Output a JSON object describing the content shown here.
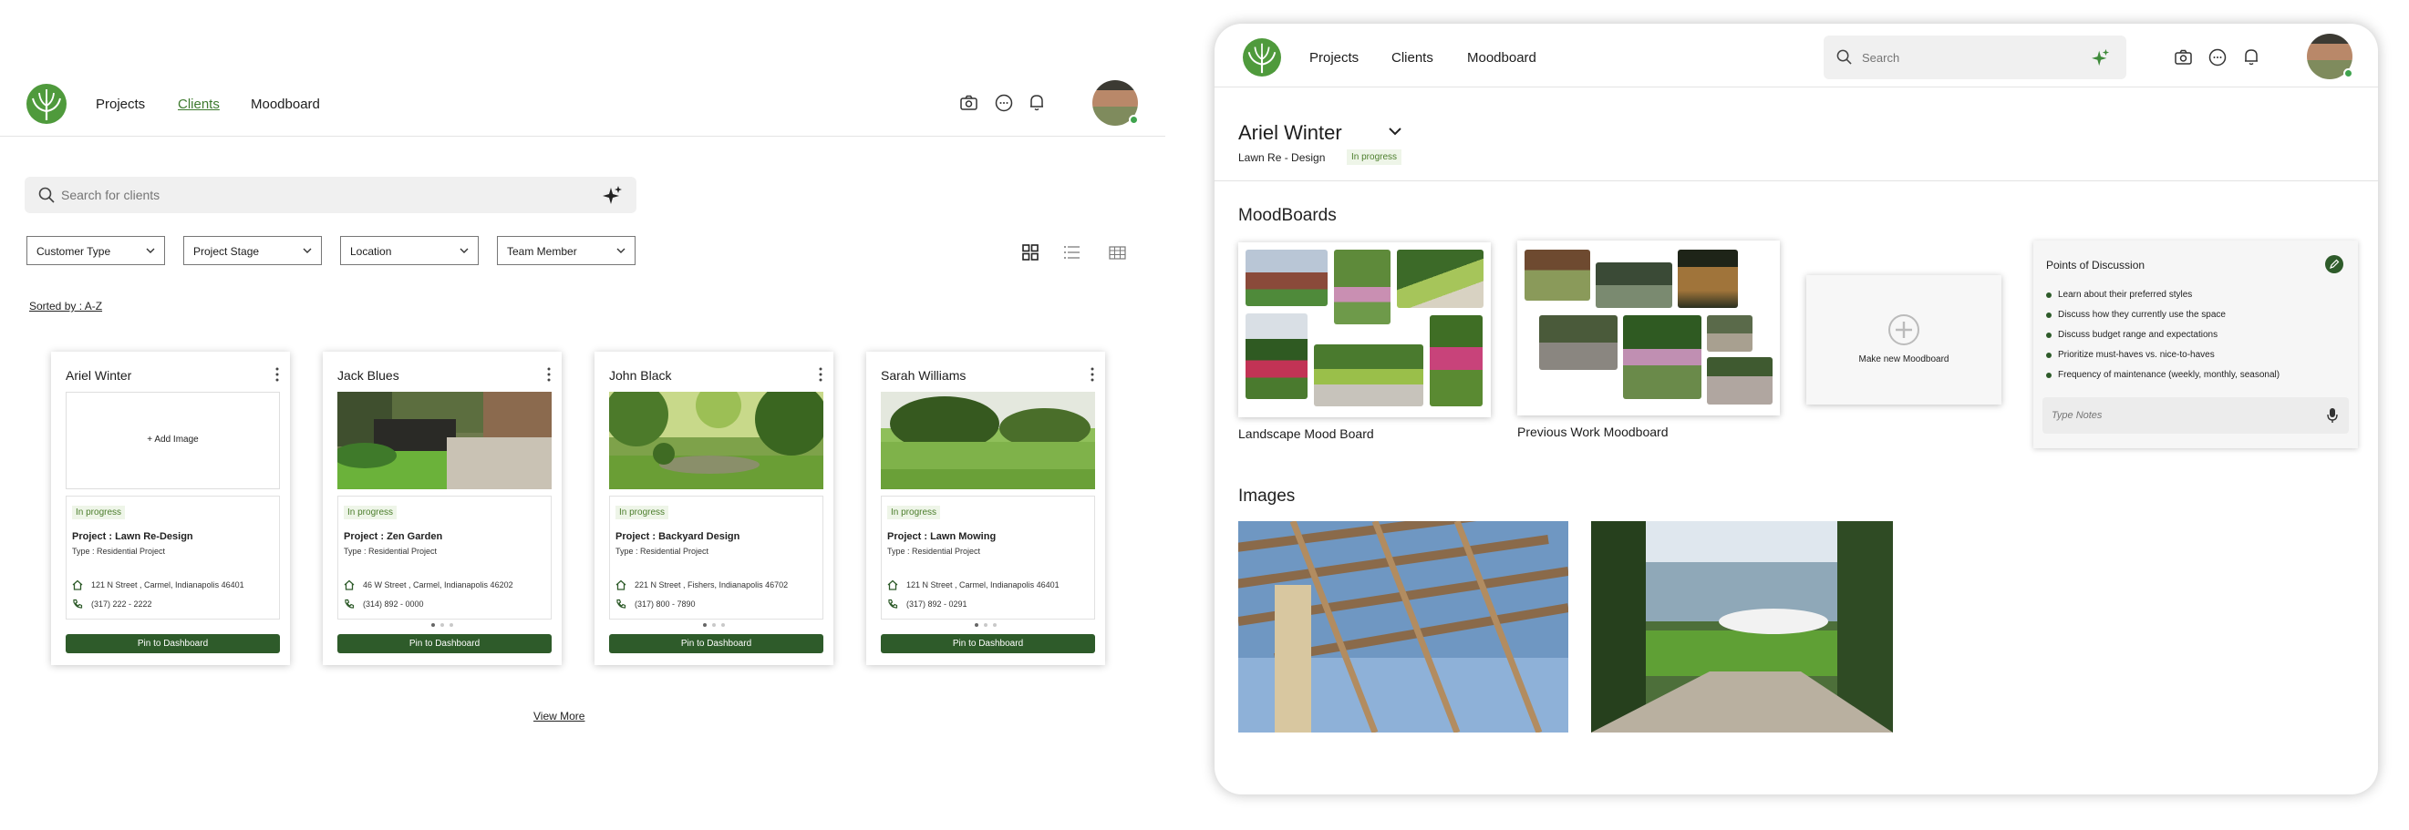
{
  "left": {
    "nav": {
      "projects": "Projects",
      "clients": "Clients",
      "moodboard": "Moodboard"
    },
    "search": {
      "placeholder": "Search for clients"
    },
    "filters": [
      "Customer Type",
      "Project Stage",
      "Location",
      "Team Member"
    ],
    "sort_label": "Sorted by : A-Z",
    "view_more": "View More",
    "cards": [
      {
        "name": "Ariel Winter",
        "add_image": "Add Image",
        "stage": "In progress",
        "project": "Project : Lawn Re-Design",
        "type": "Type : Residential Project",
        "address": "121 N Street , Carmel, Indianapolis 46401",
        "phone": "(317) 222 - 2222",
        "pin": "Pin to Dashboard"
      },
      {
        "name": "Jack Blues",
        "stage": "In progress",
        "project": "Project : Zen Garden",
        "type": "Type : Residential Project",
        "address": "46 W Street , Carmel, Indianapolis 46202",
        "phone": "(314) 892 - 0000",
        "pin": "Pin to Dashboard"
      },
      {
        "name": "John Black",
        "stage": "In progress",
        "project": "Project : Backyard Design",
        "type": "Type : Residential Project",
        "address": "221 N Street , Fishers, Indianapolis 46702",
        "phone": "(317) 800 - 7890",
        "pin": "Pin to Dashboard"
      },
      {
        "name": "Sarah Williams",
        "stage": "In progress",
        "project": "Project : Lawn Mowing",
        "type": "Type : Residential Project",
        "address": "121 N Street , Carmel, Indianapolis 46401",
        "phone": "(317) 892 - 0291",
        "pin": "Pin to Dashboard"
      }
    ]
  },
  "right": {
    "nav": {
      "projects": "Projects",
      "clients": "Clients",
      "moodboard": "Moodboard"
    },
    "search": {
      "placeholder": "Search"
    },
    "client": {
      "name": "Ariel Winter",
      "project": "Lawn Re - Design",
      "status": "In progress"
    },
    "moodboards_heading": "MoodBoards",
    "moodboards": [
      {
        "title": "Landscape Mood Board"
      },
      {
        "title": "Previous Work Moodboard"
      }
    ],
    "new_moodboard": "Make new Moodboard",
    "pod": {
      "title": "Points of Discussion",
      "items": [
        "Learn about their preferred styles",
        "Discuss how they currently use the space",
        "Discuss budget range and expectations",
        "Prioritize must-haves vs. nice-to-haves",
        "Frequency of maintenance (weekly, monthly, seasonal)"
      ],
      "notes_placeholder": "Type Notes"
    },
    "images_heading": "Images"
  },
  "colors": {
    "accent": "#2e5b2a",
    "status_text": "#4c7e2c",
    "status_bg": "#eef5e8",
    "link": "#3e7a2e"
  }
}
